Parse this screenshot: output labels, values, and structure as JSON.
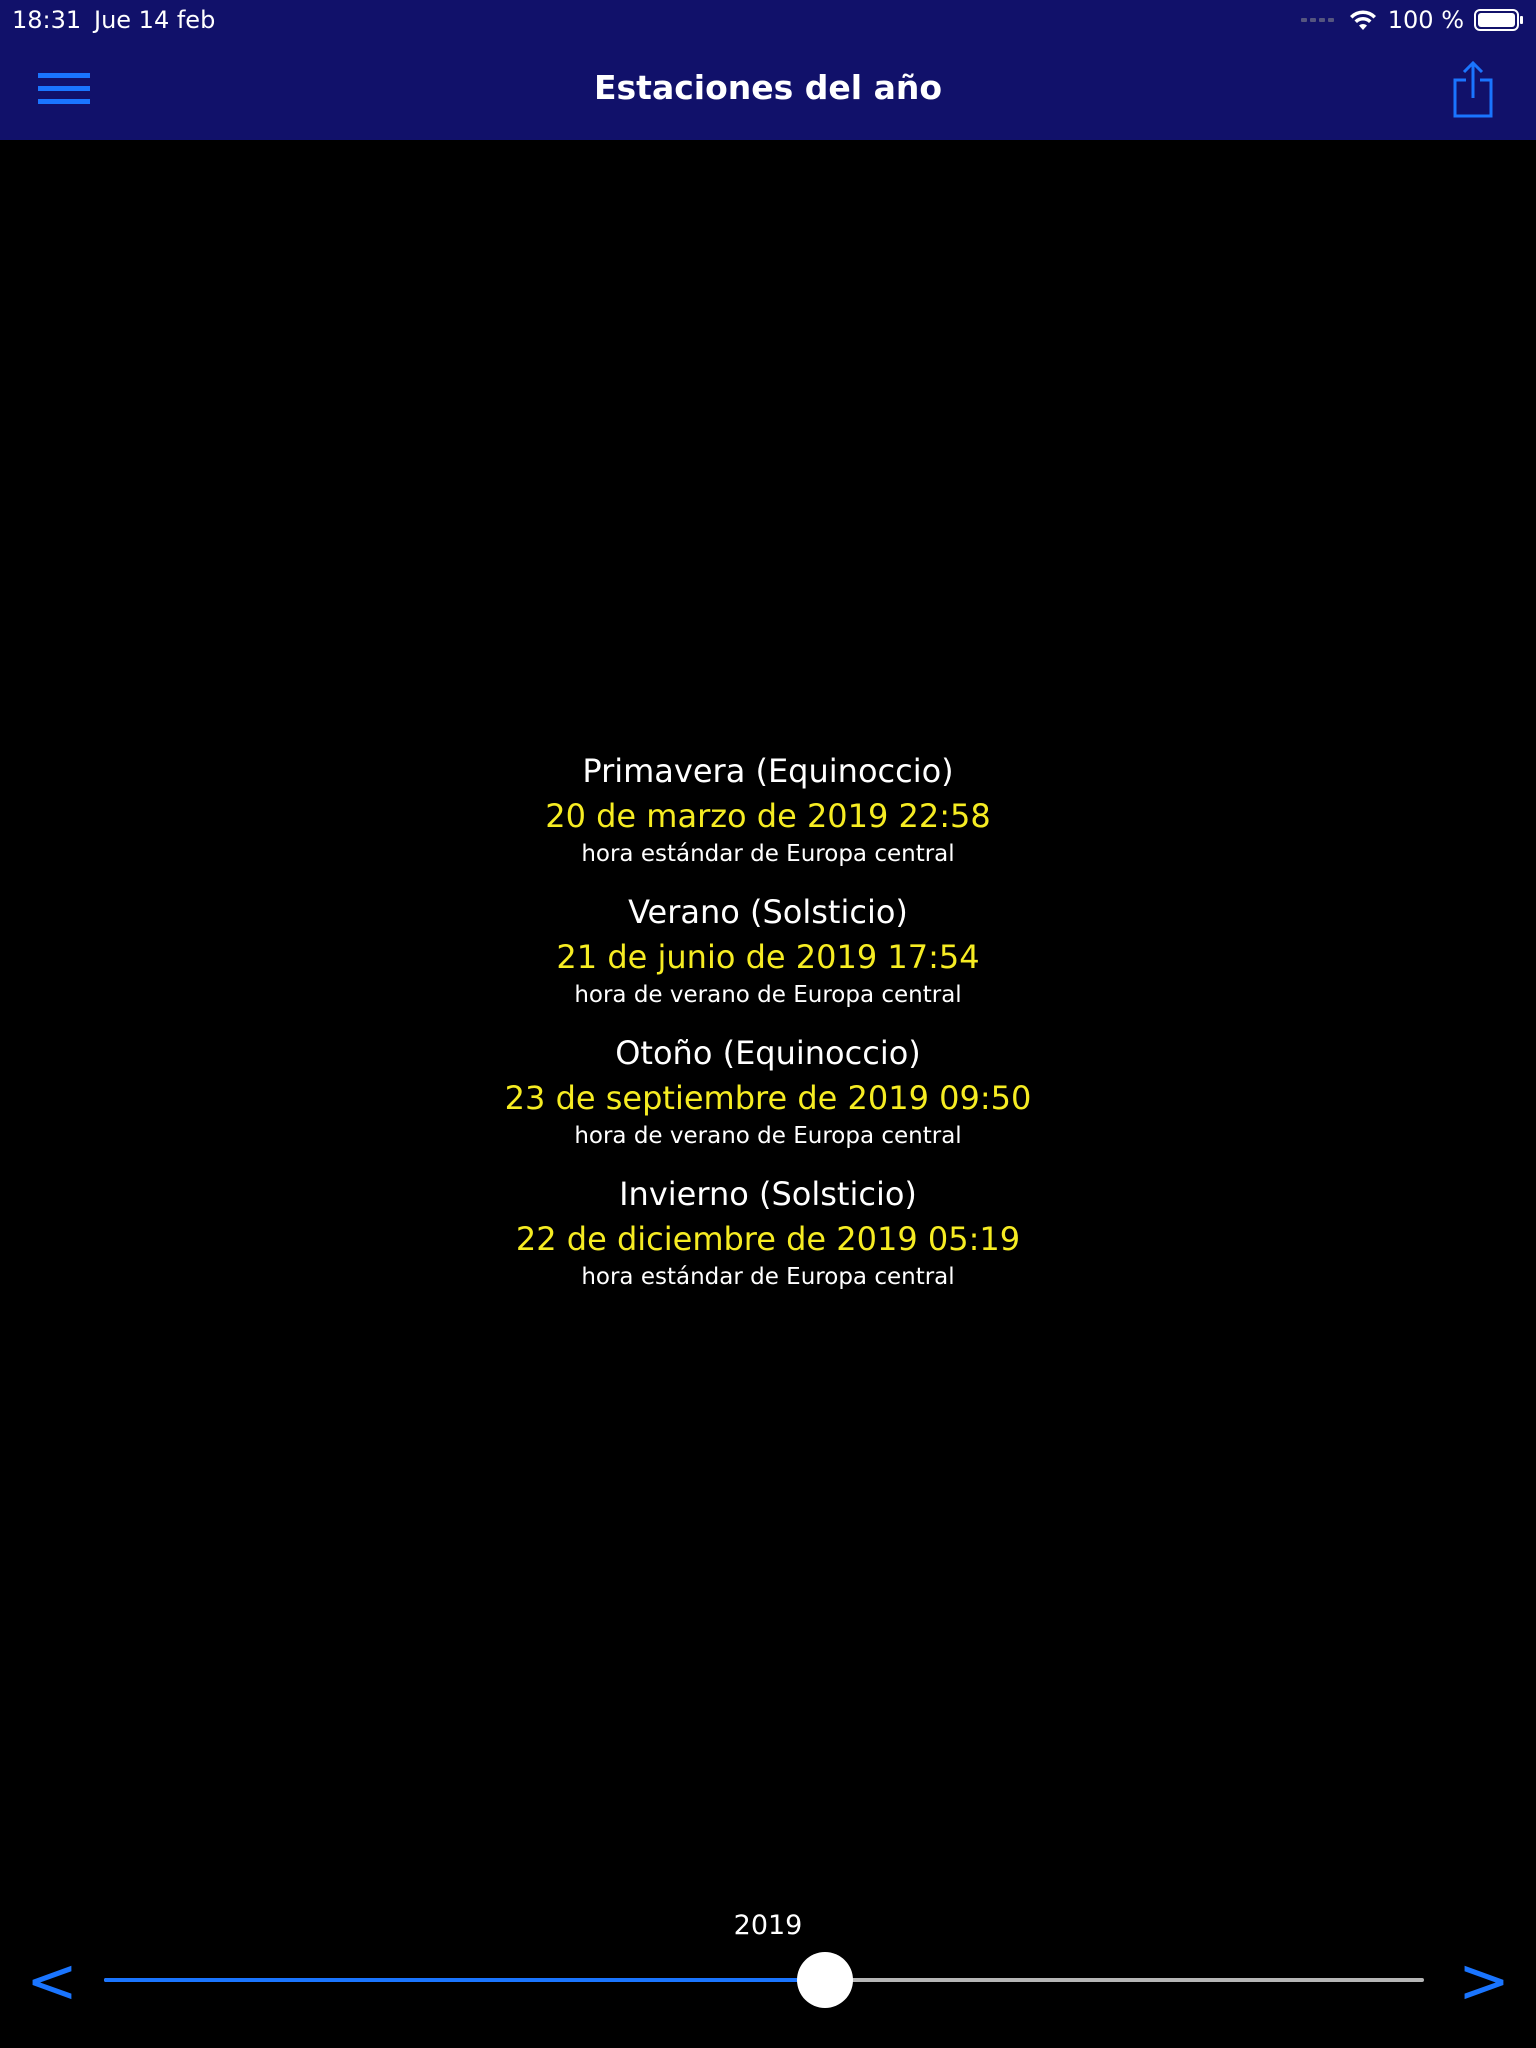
{
  "status_bar": {
    "time": "18:31",
    "date": "Jue 14 feb",
    "battery_text": "100 %",
    "wifi_icon": "wifi-icon",
    "battery_icon": "battery-icon"
  },
  "nav": {
    "title": "Estaciones del año",
    "menu_icon": "hamburger-menu-icon",
    "share_icon": "share-icon"
  },
  "seasons": [
    {
      "name": "Primavera (Equinoccio)",
      "date": "20 de marzo de 2019 22:58",
      "zone": "hora estándar de Europa central"
    },
    {
      "name": "Verano (Solsticio)",
      "date": "21 de junio de 2019 17:54",
      "zone": "hora de verano de Europa central"
    },
    {
      "name": "Otoño (Equinoccio)",
      "date": "23 de septiembre de 2019 09:50",
      "zone": "hora de verano de Europa central"
    },
    {
      "name": "Invierno (Solsticio)",
      "date": "22 de diciembre de 2019 05:19",
      "zone": "hora estándar de Europa central"
    }
  ],
  "year_control": {
    "year": "2019",
    "prev_label": "<",
    "next_label": ">",
    "slider_fraction": 0.546
  },
  "colors": {
    "bar_background": "#11116a",
    "accent": "#1a75ff",
    "date_text": "#f6ec22",
    "track": "#b5b5b5"
  }
}
